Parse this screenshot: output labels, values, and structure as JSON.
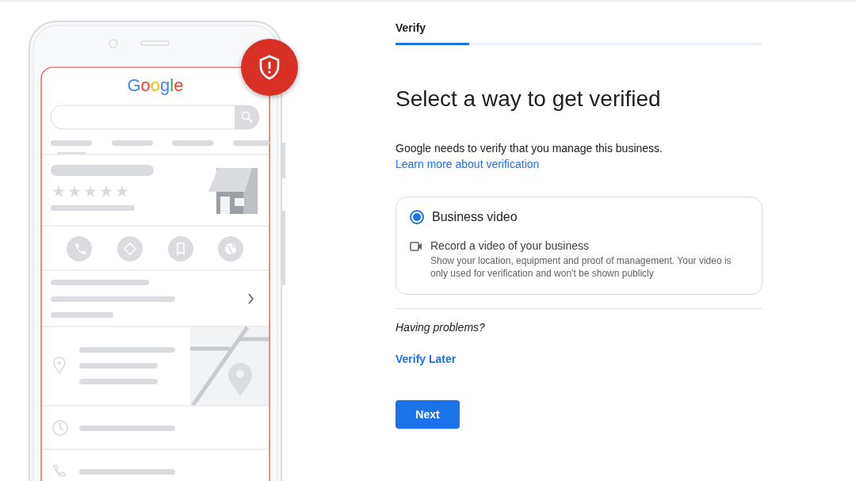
{
  "illustration": {
    "logo": "Google"
  },
  "progress": {
    "step_label": "Verify",
    "level": 0.2
  },
  "heading": "Select a way to get verified",
  "description": "Google needs to verify that you manage this business.",
  "learn_more_link": "Learn more about verification",
  "options": [
    {
      "title": "Business video",
      "selected": true,
      "method_title": "Record a video of your business",
      "method_description": "Show your location, equipment and proof of management. Your video is only used for verification and won't be shown publicly"
    }
  ],
  "help": {
    "question": "Having problems?",
    "verify_later_link": "Verify Later"
  },
  "next_button": "Next"
}
